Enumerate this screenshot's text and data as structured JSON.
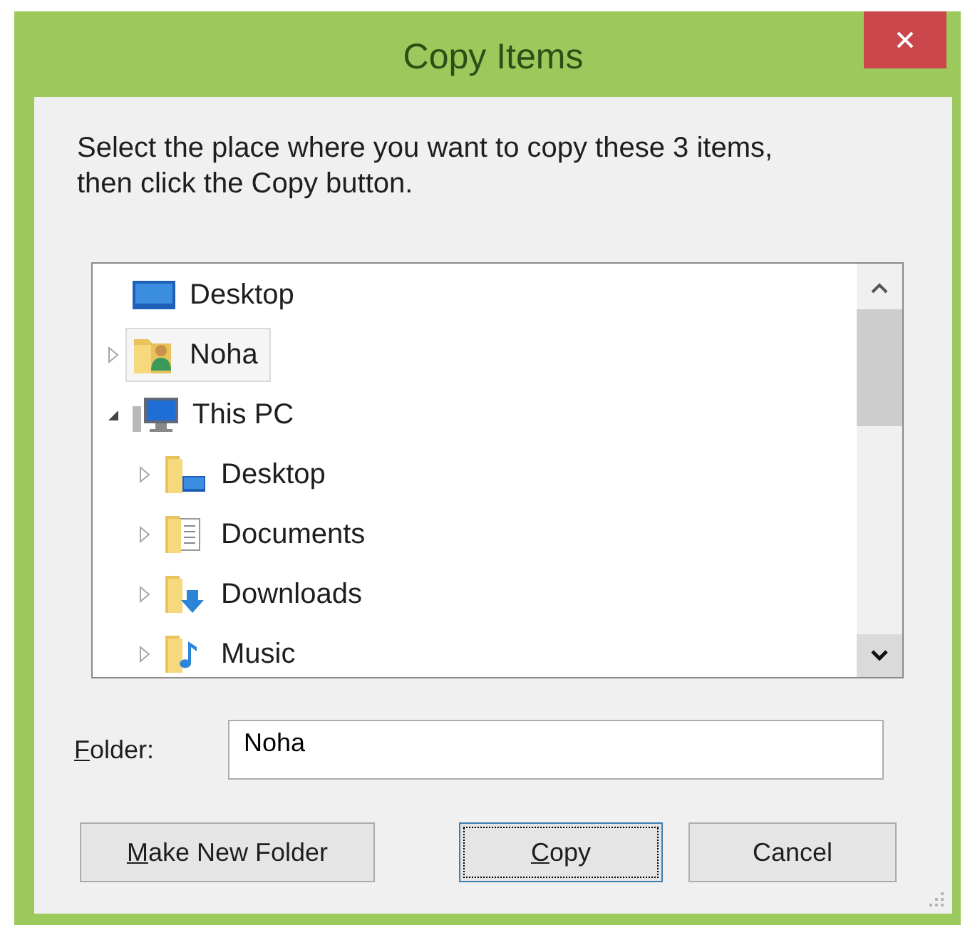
{
  "window": {
    "title": "Copy Items"
  },
  "instruction": "Select the place where you want to copy these 3 items, then click the Copy button.",
  "tree": [
    {
      "label": "Desktop",
      "kind": "desktop",
      "selected": false
    },
    {
      "label": "Noha",
      "kind": "user-folder",
      "selected": true,
      "expanded": false
    },
    {
      "label": "This PC",
      "kind": "computer",
      "selected": false,
      "expanded": true,
      "children": [
        {
          "label": "Desktop",
          "kind": "folder-desktop",
          "selected": false,
          "expanded": false
        },
        {
          "label": "Documents",
          "kind": "documents",
          "selected": false,
          "expanded": false
        },
        {
          "label": "Downloads",
          "kind": "downloads",
          "selected": false,
          "expanded": false
        },
        {
          "label": "Music",
          "kind": "music",
          "selected": false,
          "expanded": false
        }
      ]
    }
  ],
  "folder": {
    "mnemonic": "F",
    "label_rest": "older:",
    "value": "Noha"
  },
  "buttons": [
    {
      "mnemonic": "M",
      "label_rest": "ake New Folder",
      "focused": false
    },
    {
      "mnemonic": "C",
      "label_rest": "opy",
      "focused": true
    },
    {
      "label_rest": "Cancel",
      "focused": false
    }
  ]
}
